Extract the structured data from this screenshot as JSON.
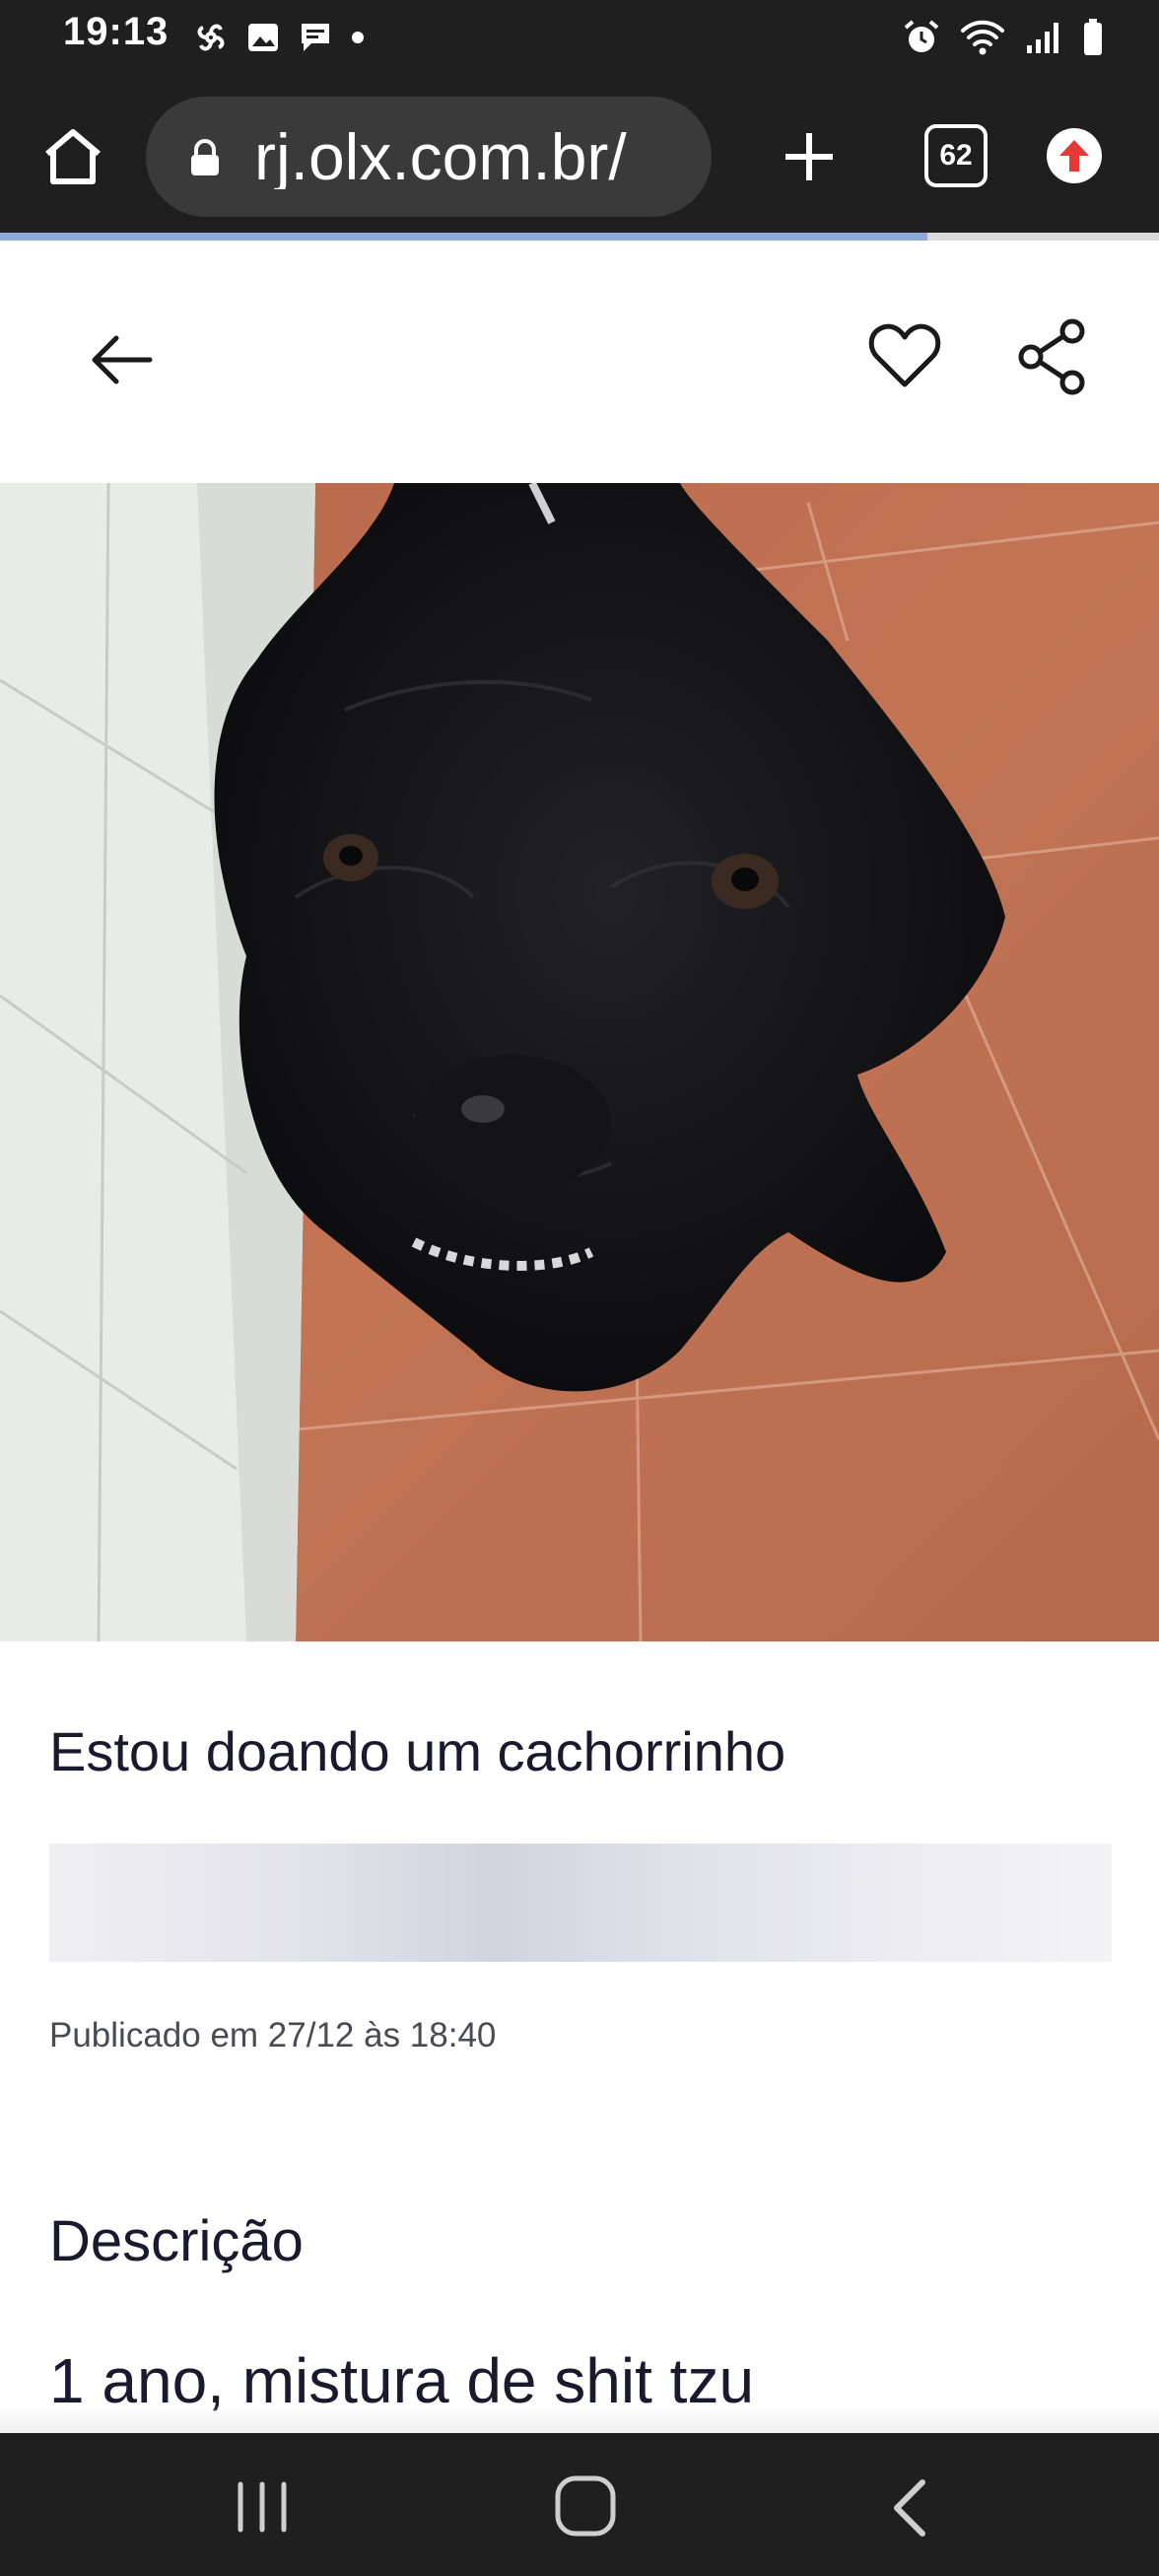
{
  "status_bar": {
    "time": "19:13",
    "left_icons": [
      "pinwheel-icon",
      "gallery-icon",
      "message-icon",
      "dot-icon"
    ],
    "right_icons": [
      "alarm-icon",
      "wifi-icon",
      "signal-icon",
      "battery-icon"
    ]
  },
  "browser": {
    "url": "rj.olx.com.br/",
    "tab_count": "62",
    "page_load_progress": 0.8
  },
  "listing": {
    "title": "Estou doando um cachorrinho",
    "published": "Publicado em 27/12 às 18:40",
    "description_heading": "Descrição",
    "description_text": "1 ano, mistura de shit tzu"
  },
  "colors": {
    "bars": "#1f1f1f",
    "progress": "#8fa9d6",
    "text": "#1a1a2e",
    "update_badge": "#e53935"
  }
}
